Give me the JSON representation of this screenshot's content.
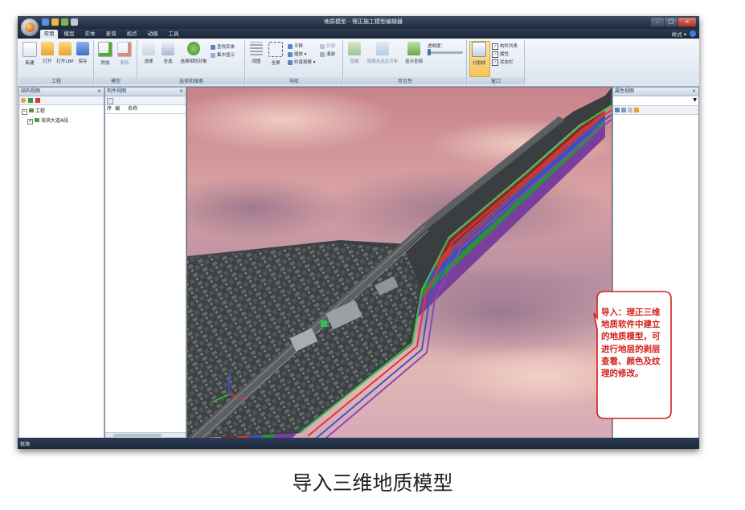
{
  "window": {
    "title": "地质模型 - 理正施工模型编辑器",
    "style_label": "样式 ▾"
  },
  "ribbon": {
    "tabs": [
      "常用",
      "模型",
      "实体",
      "查询",
      "视点",
      "动画",
      "工具"
    ],
    "groups": {
      "project": {
        "label": "工程",
        "buttons": [
          "新建",
          "打开",
          "打开LBP",
          "保存"
        ]
      },
      "model": {
        "label": "模型",
        "buttons": [
          "附加",
          "删除"
        ]
      },
      "selection": {
        "label": "选择和搜索",
        "buttons": [
          "选择",
          "全选",
          "选择相同对象"
        ],
        "small": [
          "查找实体",
          "集中显示"
        ]
      },
      "navigation": {
        "label": "导航",
        "buttons": [
          "视图",
          "全屏"
        ],
        "small": [
          "平移",
          "缩放",
          "约束观察",
          "环视",
          "漫游"
        ]
      },
      "visibility": {
        "label": "可见性",
        "buttons": [
          "隐藏",
          "隐藏未选定对象",
          "显示全部"
        ],
        "transparency_label": "透明度："
      },
      "window": {
        "label": "窗口",
        "button": "分割线",
        "checks": [
          "构件列表",
          "属性",
          "状态栏"
        ]
      }
    }
  },
  "panels": {
    "structure": {
      "title": "结构视图",
      "tree": [
        {
          "label": "工程",
          "level": 0
        },
        {
          "label": "海滨大道A段",
          "level": 1
        }
      ]
    },
    "components": {
      "title": "构件视图",
      "columns": [
        "序",
        "编",
        "名称"
      ]
    },
    "properties": {
      "title": "属性视图"
    }
  },
  "status": {
    "text": "就绪"
  },
  "callout": {
    "text": "导入：理正三维地质软件中建立的地质模型，可进行地层的剥层查看、颜色及纹理的修改。"
  },
  "caption": "导入三维地质模型",
  "colors": {
    "titlebar": "#1f2a3a",
    "callout_border": "#d2201c",
    "highlight": "#f6c45a"
  }
}
